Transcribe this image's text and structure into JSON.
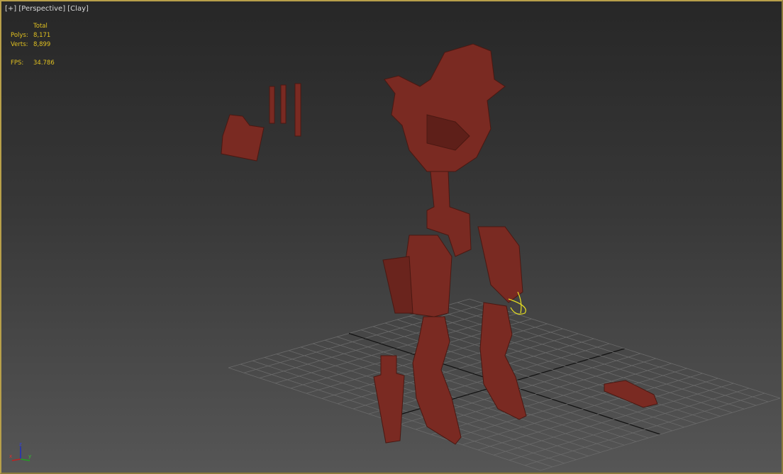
{
  "viewport": {
    "labels": [
      "[+]",
      "[Perspective]",
      "[Clay]"
    ],
    "active_border_color": "#b8a04a"
  },
  "stats": {
    "header": "Total",
    "polys_label": "Polys:",
    "polys": "8,171",
    "verts_label": "Verts:",
    "verts": "8,899",
    "fps_label": "FPS:",
    "fps": "34.786"
  },
  "gizmo": {
    "x": "x",
    "y": "y",
    "z": "z"
  },
  "colors": {
    "model": "#7a2a22",
    "grid": "#6a6a6a",
    "axis": "#111111",
    "stats": "#e0c020"
  }
}
